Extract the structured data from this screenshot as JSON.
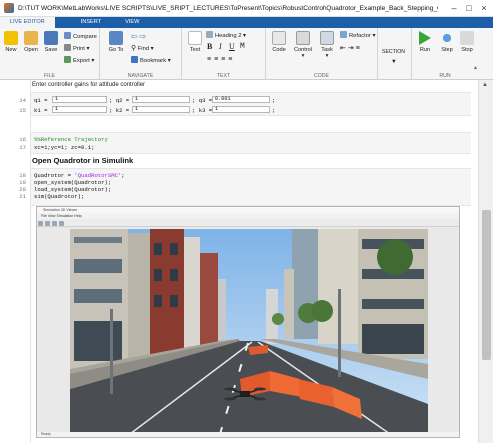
{
  "window": {
    "title": "D:\\TUT WORK\\MetLabWorks\\LIVE SCRIPTS\\LIVE_SRIPT_LECTURES\\ToPresent\\Topics\\RobustControl\\Quadrotor_Example_Back_Stepping_Control.mlx"
  },
  "tabs": [
    "LIVE EDITOR",
    "INSERT",
    "VIEW"
  ],
  "toolstrip": {
    "file": {
      "label": "FILE",
      "new": "New",
      "open": "Open",
      "save": "Save",
      "compare": "Compare",
      "print": "Print",
      "export": "Export"
    },
    "navigate": {
      "label": "NAVIGATE",
      "goto": "Go To",
      "find": "Find",
      "bookmark": "Bookmark"
    },
    "text": {
      "label": "TEXT",
      "text": "Text",
      "heading": "Heading 2",
      "bold": "B",
      "italic": "I",
      "underline": "U",
      "mono": "M"
    },
    "code": {
      "label": "CODE",
      "code": "Code",
      "control": "Control",
      "task": "Task",
      "refactor": "Refactor"
    },
    "section": {
      "label": "SECTION",
      "section": "SECTION"
    },
    "run": {
      "label": "RUN",
      "run": "Run",
      "step": "Step",
      "stop": "Stop"
    }
  },
  "editor": {
    "intro_text": "Enter controller gains for attitude controller",
    "gains": {
      "lines": [
        "14",
        "15"
      ],
      "row1": {
        "q1_label": "q1 =",
        "q1": "1",
        "q2_label": "; q2 =",
        "q2": "1",
        "q3_label": "; q3 =",
        "q3": "0.001",
        "end": ";"
      },
      "row2": {
        "k1_label": "k1 =",
        "k1": "1",
        "k2_label": "; k2 =",
        "k2": "1",
        "k3_label": "; k3 =",
        "k3": "1",
        "end": ";"
      }
    },
    "trajectory": {
      "lines": [
        "16",
        "17"
      ],
      "comment": "%%Reference Trajectory",
      "code": "xc=1;yc=1; zc=0.1;"
    },
    "simulink_heading": "Open Quadrotor in Simulink",
    "simulink_code": {
      "lines": [
        "18",
        "19",
        "20",
        "21"
      ],
      "l1_pre": "Quadrotor = ",
      "l1_str": "'QuadRotorSMC'",
      "l1_post": ";",
      "l2": "open_system(Quadrotor);",
      "l3": "load_system(Quadrotor);",
      "l4": "sim(Quadrotor);"
    }
  },
  "figure": {
    "title": "Simulation 3D Viewer",
    "menu": "File   View   Simulation   Help",
    "status": "Ready"
  }
}
